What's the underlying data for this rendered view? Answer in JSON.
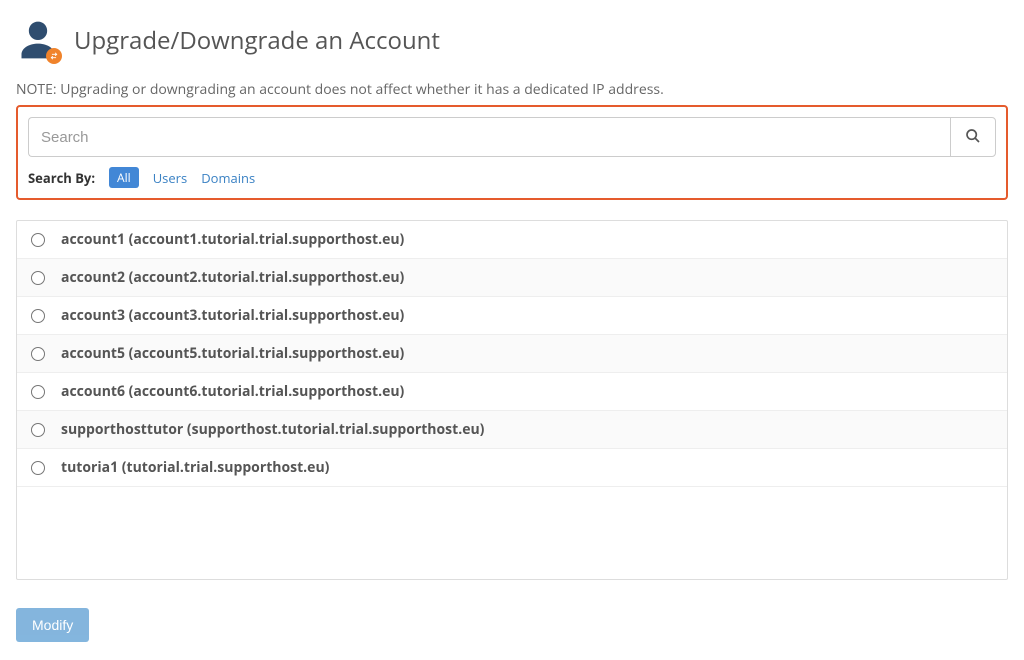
{
  "header": {
    "title": "Upgrade/Downgrade an Account"
  },
  "note": "NOTE: Upgrading or downgrading an account does not affect whether it has a dedicated IP address.",
  "search": {
    "placeholder": "Search",
    "value": "",
    "by_label": "Search By:",
    "tabs": {
      "all": "All",
      "users": "Users",
      "domains": "Domains"
    }
  },
  "accounts": [
    {
      "label": "account1 (account1.tutorial.trial.supporthost.eu)"
    },
    {
      "label": "account2 (account2.tutorial.trial.supporthost.eu)"
    },
    {
      "label": "account3 (account3.tutorial.trial.supporthost.eu)"
    },
    {
      "label": "account5 (account5.tutorial.trial.supporthost.eu)"
    },
    {
      "label": "account6 (account6.tutorial.trial.supporthost.eu)"
    },
    {
      "label": "supporthosttutor (supporthost.tutorial.trial.supporthost.eu)"
    },
    {
      "label": "tutoria1 (tutorial.trial.supporthost.eu)"
    }
  ],
  "buttons": {
    "modify": "Modify"
  }
}
